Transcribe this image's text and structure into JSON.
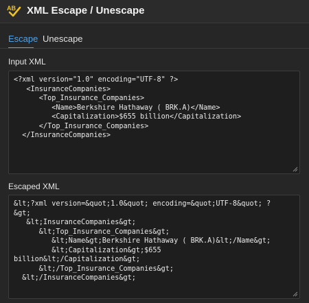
{
  "header": {
    "title": "XML Escape / Unescape",
    "logo_text": "AB"
  },
  "tabs": [
    {
      "label": "Escape",
      "active": true
    },
    {
      "label": "Unescape",
      "active": false
    }
  ],
  "input": {
    "label": "Input XML",
    "lines": [
      "<?xml version=\"1.0\" encoding=\"UTF-8\" ?>",
      "   <InsuranceCompanies>",
      "      <Top_Insurance_Companies>",
      "         <Name>Berkshire Hathaway ( BRK.A)</Name>",
      "         <Capitalization>$655 billion</Capitalization>",
      "      </Top_Insurance_Companies>",
      "  </InsuranceCompanies>"
    ]
  },
  "output": {
    "label": "Escaped XML",
    "lines": [
      "&lt;?xml version=&quot;1.0&quot; encoding=&quot;UTF-8&quot; ?",
      "&gt;",
      "   &lt;InsuranceCompanies&gt;",
      "      &lt;Top_Insurance_Companies&gt;",
      "         &lt;Name&gt;Berkshire Hathaway ( BRK.A)&lt;/Name&gt;",
      "         &lt;Capitalization&gt;$655",
      "billion&lt;/Capitalization&gt;",
      "      &lt;/Top_Insurance_Companies&gt;",
      "  &lt;/InsuranceCompanies&gt;"
    ]
  },
  "colors": {
    "accent": "#4fa3e8",
    "logo": "#f2c21b",
    "background": "#262626",
    "field": "#1e1e1e"
  }
}
